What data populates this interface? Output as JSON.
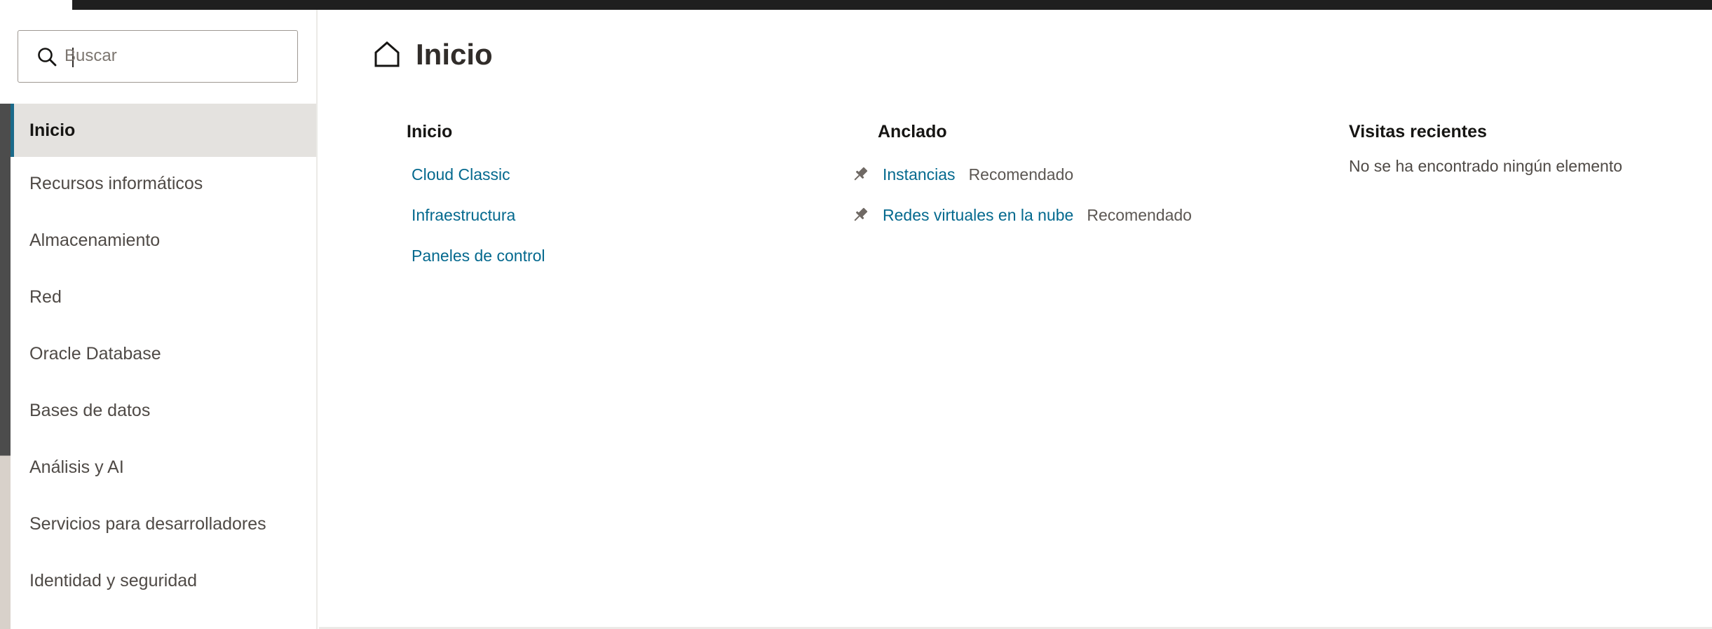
{
  "search": {
    "placeholder": "Buscar",
    "value": ""
  },
  "sidebar": {
    "items": [
      {
        "label": "Inicio",
        "active": true
      },
      {
        "label": "Recursos informáticos"
      },
      {
        "label": "Almacenamiento"
      },
      {
        "label": "Red"
      },
      {
        "label": "Oracle Database"
      },
      {
        "label": "Bases de datos"
      },
      {
        "label": "Análisis y AI"
      },
      {
        "label": "Servicios para desarrolladores"
      },
      {
        "label": "Identidad y seguridad"
      }
    ]
  },
  "page": {
    "title": "Inicio",
    "icon": "home-icon"
  },
  "columns": {
    "inicio": {
      "heading": "Inicio",
      "links": [
        "Cloud Classic",
        "Infraestructura",
        "Paneles de control"
      ]
    },
    "anclado": {
      "heading": "Anclado",
      "items": [
        {
          "label": "Instancias",
          "tag": "Recomendado",
          "icon": "pin-icon"
        },
        {
          "label": "Redes virtuales en la nube",
          "tag": "Recomendado",
          "icon": "pin-icon"
        }
      ]
    },
    "recientes": {
      "heading": "Visitas recientes",
      "empty": "No se ha encontrado ningún elemento"
    }
  },
  "colors": {
    "accent": "#1b6a8a",
    "link": "#04698e",
    "topbar": "#1f1f1f"
  }
}
